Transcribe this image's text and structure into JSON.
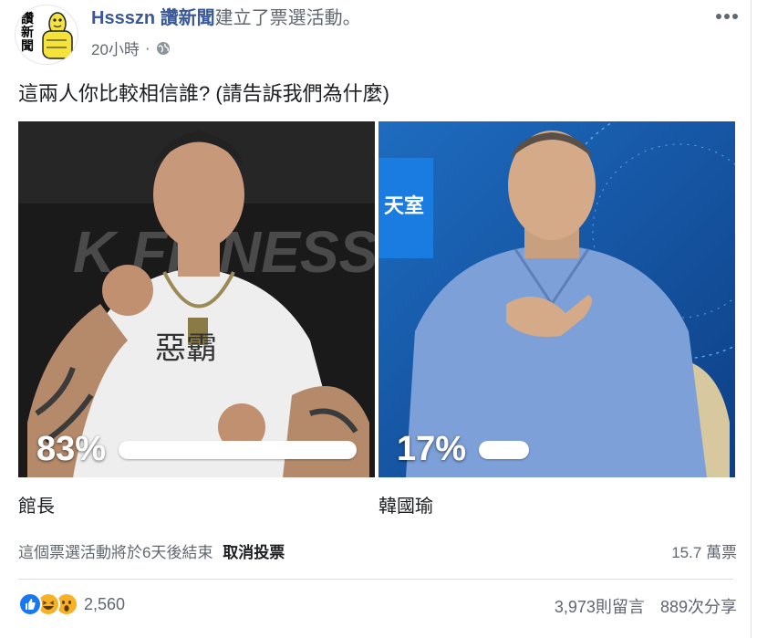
{
  "post": {
    "page_name": "Hssszn 讚新聞",
    "action": "建立了票選活動。",
    "time": "20小時",
    "separator": "·",
    "avatar_text": "讚新聞",
    "question": "這兩人你比較相信誰? (請告訴我們為什麼)"
  },
  "poll": {
    "options": [
      {
        "label": "館長",
        "percent_text": "83%",
        "percent": 83
      },
      {
        "label": "韓國瑜",
        "percent_text": "17%",
        "percent": 17
      }
    ],
    "end_text": "這個票選活動將於6天後結束",
    "cancel_label": "取消投票",
    "total_votes": "15.7 萬票",
    "image_texts": {
      "opt1_brand": "K  FITNESS",
      "opt1_shirt": "惡霸",
      "opt2_logo": "天室"
    }
  },
  "engagement": {
    "reaction_count": "2,560",
    "comments": "3,973則留言",
    "shares": "889次分享"
  },
  "colors": {
    "link": "#385898",
    "muted": "#616770",
    "like_blue": "#1877f2",
    "reaction_yellow": "#f7b125"
  },
  "icons": {
    "more": "more-horizontal-icon",
    "globe": "globe-icon",
    "like": "like-reaction-icon",
    "haha": "haha-reaction-icon",
    "wow": "wow-reaction-icon"
  }
}
